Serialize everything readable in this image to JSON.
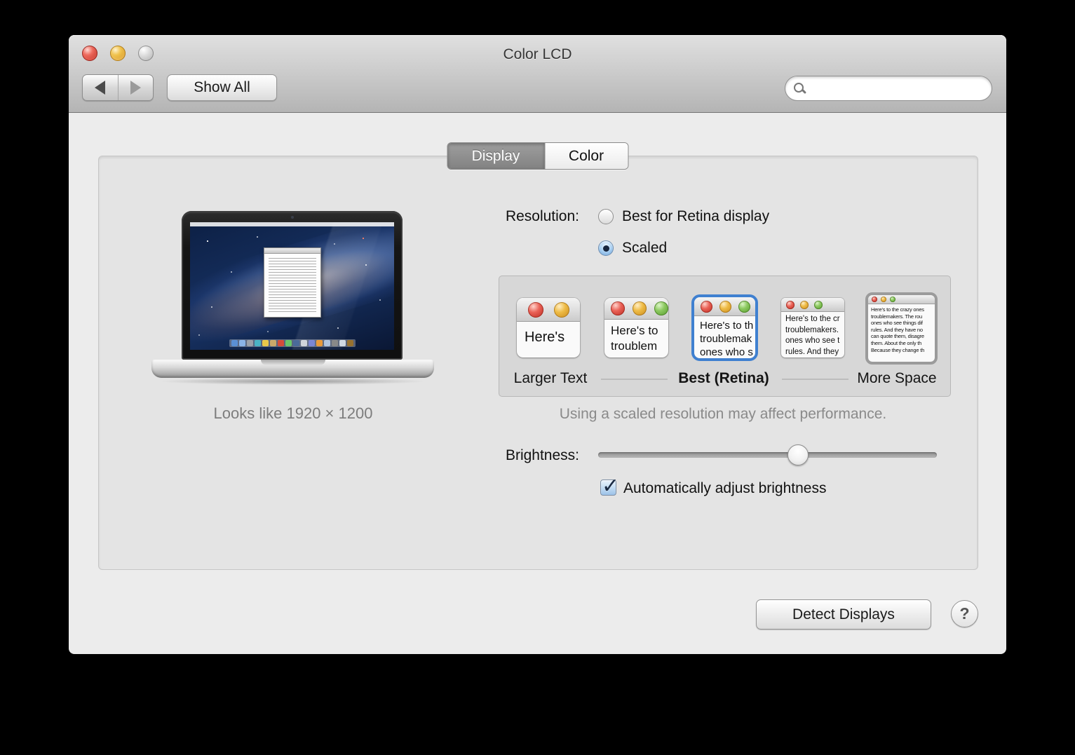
{
  "window": {
    "title": "Color LCD"
  },
  "toolbar": {
    "show_all_label": "Show All"
  },
  "search": {
    "value": ""
  },
  "tabs": {
    "display": "Display",
    "color": "Color"
  },
  "display_pane": {
    "looks_like": "Looks like 1920 × 1200",
    "resolution_label": "Resolution:",
    "radio_best": "Best for Retina display",
    "radio_scaled": "Scaled",
    "selected_radio": "Scaled",
    "note": "Using a scaled resolution may affect performance.",
    "brightness_label": "Brightness:",
    "brightness_pct": 59,
    "checkbox_label": "Automatically adjust brightness",
    "checkbox_checked": true,
    "check_glyph": "✓",
    "scaled_options": {
      "label_left": "Larger Text",
      "label_center": "Best (Retina)",
      "label_right": "More Space",
      "selected": "Best (Retina)",
      "thumbs": [
        {
          "name": "larger-text",
          "lines": [
            "Here's"
          ]
        },
        {
          "name": "larger-text-2",
          "lines": [
            "Here's to",
            "troublem"
          ]
        },
        {
          "name": "best-retina",
          "lines": [
            "Here's to th",
            "troublemak",
            "ones who s"
          ]
        },
        {
          "name": "more-space-1",
          "lines": [
            "Here's to the cr",
            "troublemakers.",
            "ones who see t",
            "rules. And they"
          ]
        },
        {
          "name": "more-space-2",
          "lines": [
            "Here's to the crazy ones",
            "troublemakers. The rou",
            "ones who see things dif",
            "rules. And they have no",
            "can quote them, disagre",
            "them. About the only th",
            "Because they change th"
          ]
        }
      ]
    }
  },
  "footer": {
    "detect_displays_label": "Detect Displays",
    "help_label": "?"
  },
  "colors": {
    "selection_blue": "#3f80d0",
    "panel_bg": "#e4e4e4",
    "window_bg": "#ececec"
  }
}
